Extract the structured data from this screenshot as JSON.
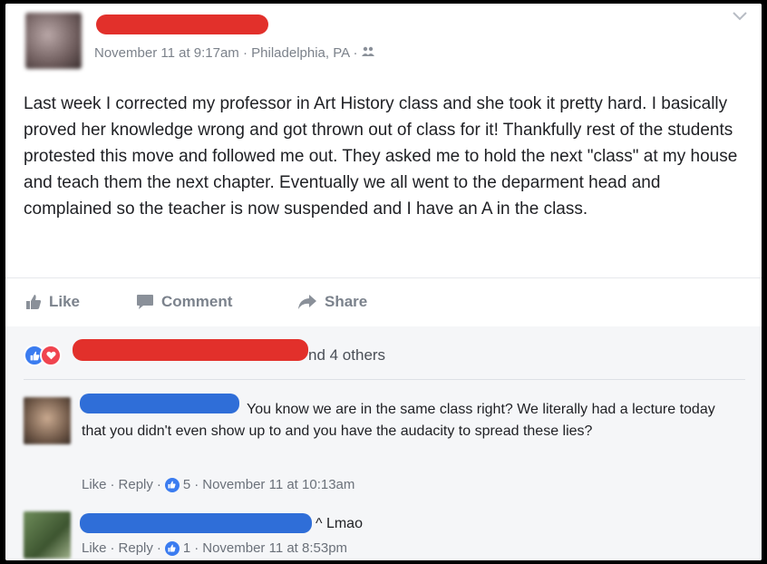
{
  "post": {
    "timestamp": "November 11 at 9:17am",
    "location": "Philadelphia, PA",
    "body": "Last week I corrected my professor in Art History class and she took it pretty hard. I basically proved her knowledge wrong and got thrown out of class for it! Thankfully rest of the students protested this move and followed me out. They asked me to hold the next \"class\" at my house and teach them the next chapter. Eventually we all went to the deparment head and complained so the teacher is now suspended and I have an A in the class."
  },
  "actions": {
    "like": "Like",
    "comment": "Comment",
    "share": "Share"
  },
  "reactions": {
    "summary_suffix": "nd 4 others"
  },
  "comments": [
    {
      "text": "You know we are in the same class right? We literally had a lecture today that you didn't even show up to and you have the audacity to spread these lies?",
      "like_label": "Like",
      "reply_label": "Reply",
      "likes": "5",
      "timestamp": "November 11 at 10:13am"
    },
    {
      "text": "^ Lmao",
      "like_label": "Like",
      "reply_label": "Reply",
      "likes": "1",
      "timestamp": "November 11 at 8:53pm"
    }
  ],
  "colors": {
    "redaction_red": "#e2302b",
    "redaction_blue": "#2f6ed8",
    "like_blue": "#3b7cf0",
    "love_red": "#f0444f"
  },
  "icons": [
    "globe-friends-icon",
    "chevron-down-icon",
    "like-thumb-icon",
    "comment-bubble-icon",
    "share-arrow-icon",
    "like-reaction-icon",
    "love-reaction-icon"
  ]
}
